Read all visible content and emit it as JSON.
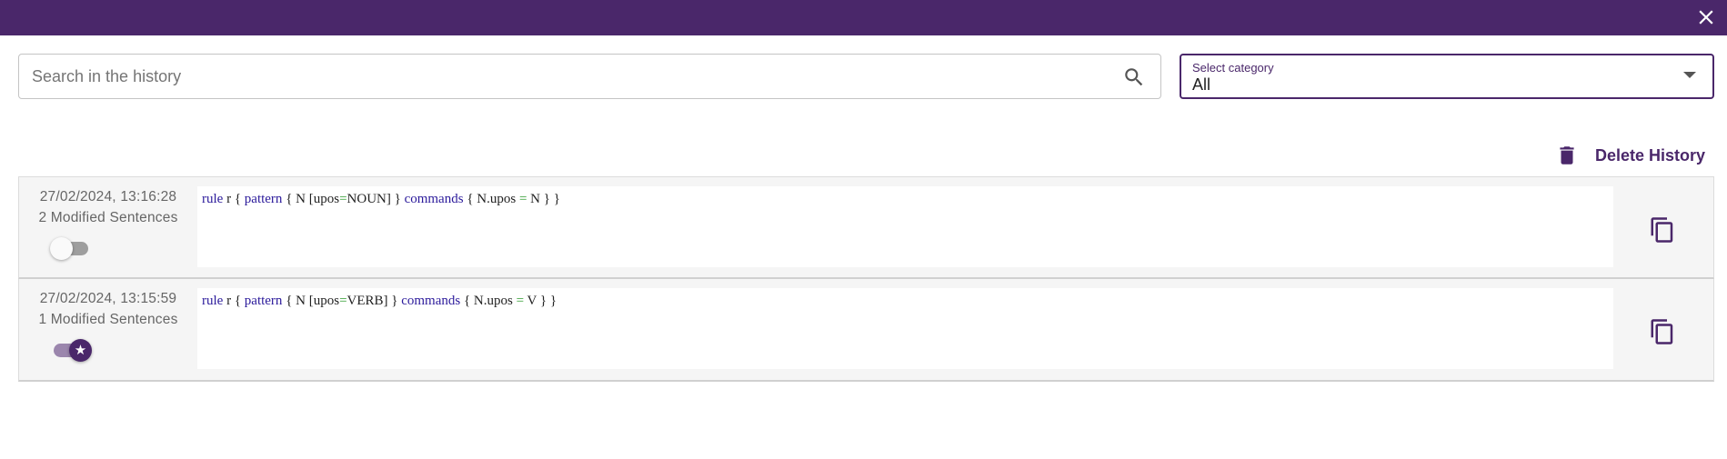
{
  "topbar": {
    "close_icon": "close-icon",
    "color": "#4a276a"
  },
  "search": {
    "placeholder": "Search in the history",
    "value": "",
    "icon": "search-icon"
  },
  "category_select": {
    "label": "Select category",
    "value": "All",
    "icon": "arrow-drop-down-icon"
  },
  "delete_history": {
    "label": "Delete History",
    "icon": "trash-icon"
  },
  "history": [
    {
      "timestamp": "27/02/2024, 13:16:28",
      "modified": "2 Modified Sentences",
      "favorite": false,
      "code": {
        "kw1": "rule",
        "t1": " r { ",
        "kw2": "pattern",
        "t2": " { N [upos",
        "op1": "=",
        "t3": "NOUN] } ",
        "kw3": "commands",
        "t4": " { N.upos ",
        "op2": "=",
        "t5": " N } }"
      }
    },
    {
      "timestamp": "27/02/2024, 13:15:59",
      "modified": "1 Modified Sentences",
      "favorite": true,
      "code": {
        "kw1": "rule",
        "t1": " r { ",
        "kw2": "pattern",
        "t2": " { N [upos",
        "op1": "=",
        "t3": "VERB] } ",
        "kw3": "commands",
        "t4": " { N.upos ",
        "op2": "=",
        "t5": " V } }"
      }
    }
  ],
  "colors": {
    "primary": "#4a276a",
    "keyword": "#2b1a9b",
    "operator": "#2e9b2e"
  }
}
